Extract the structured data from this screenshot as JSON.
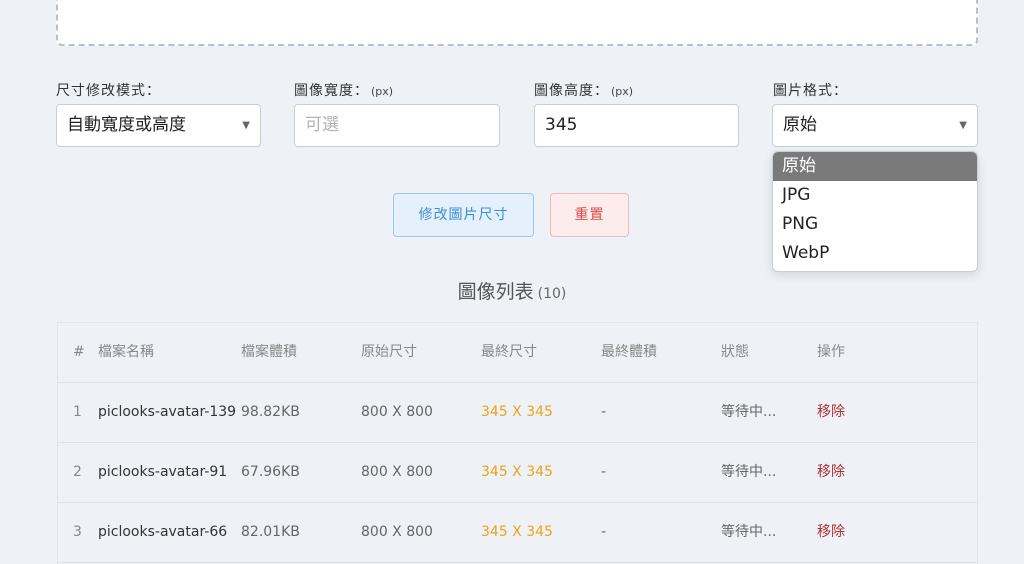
{
  "form": {
    "mode_label": "尺寸修改模式：",
    "mode_value": "自動寬度或高度",
    "width_label": "圖像寬度：",
    "width_unit": "(px)",
    "width_placeholder": "可選",
    "height_label": "圖像高度：",
    "height_unit": "(px)",
    "height_value": "345",
    "format_label": "圖片格式：",
    "format_value": "原始",
    "format_options": [
      "原始",
      "JPG",
      "PNG",
      "WebP"
    ]
  },
  "actions": {
    "resize_label": "修改圖片尺寸",
    "reset_label": "重置"
  },
  "list": {
    "title": "圖像列表",
    "count": "(10)",
    "headers": [
      "#",
      "檔案名稱",
      "檔案體積",
      "原始尺寸",
      "最終尺寸",
      "最終體積",
      "狀態",
      "操作"
    ],
    "rows": [
      {
        "idx": "1",
        "name": "piclooks-avatar-139",
        "size": "98.82KB",
        "orig": "800 X 800",
        "final": "345 X 345",
        "fsize": "-",
        "status": "等待中...",
        "op": "移除"
      },
      {
        "idx": "2",
        "name": "piclooks-avatar-91",
        "size": "67.96KB",
        "orig": "800 X 800",
        "final": "345 X 345",
        "fsize": "-",
        "status": "等待中...",
        "op": "移除"
      },
      {
        "idx": "3",
        "name": "piclooks-avatar-66",
        "size": "82.01KB",
        "orig": "800 X 800",
        "final": "345 X 345",
        "fsize": "-",
        "status": "等待中...",
        "op": "移除"
      }
    ]
  },
  "colors": {
    "accent": "#3a8fd8",
    "danger": "#e14b4b",
    "final_size": "#f0a01a",
    "remove": "#b03030"
  }
}
